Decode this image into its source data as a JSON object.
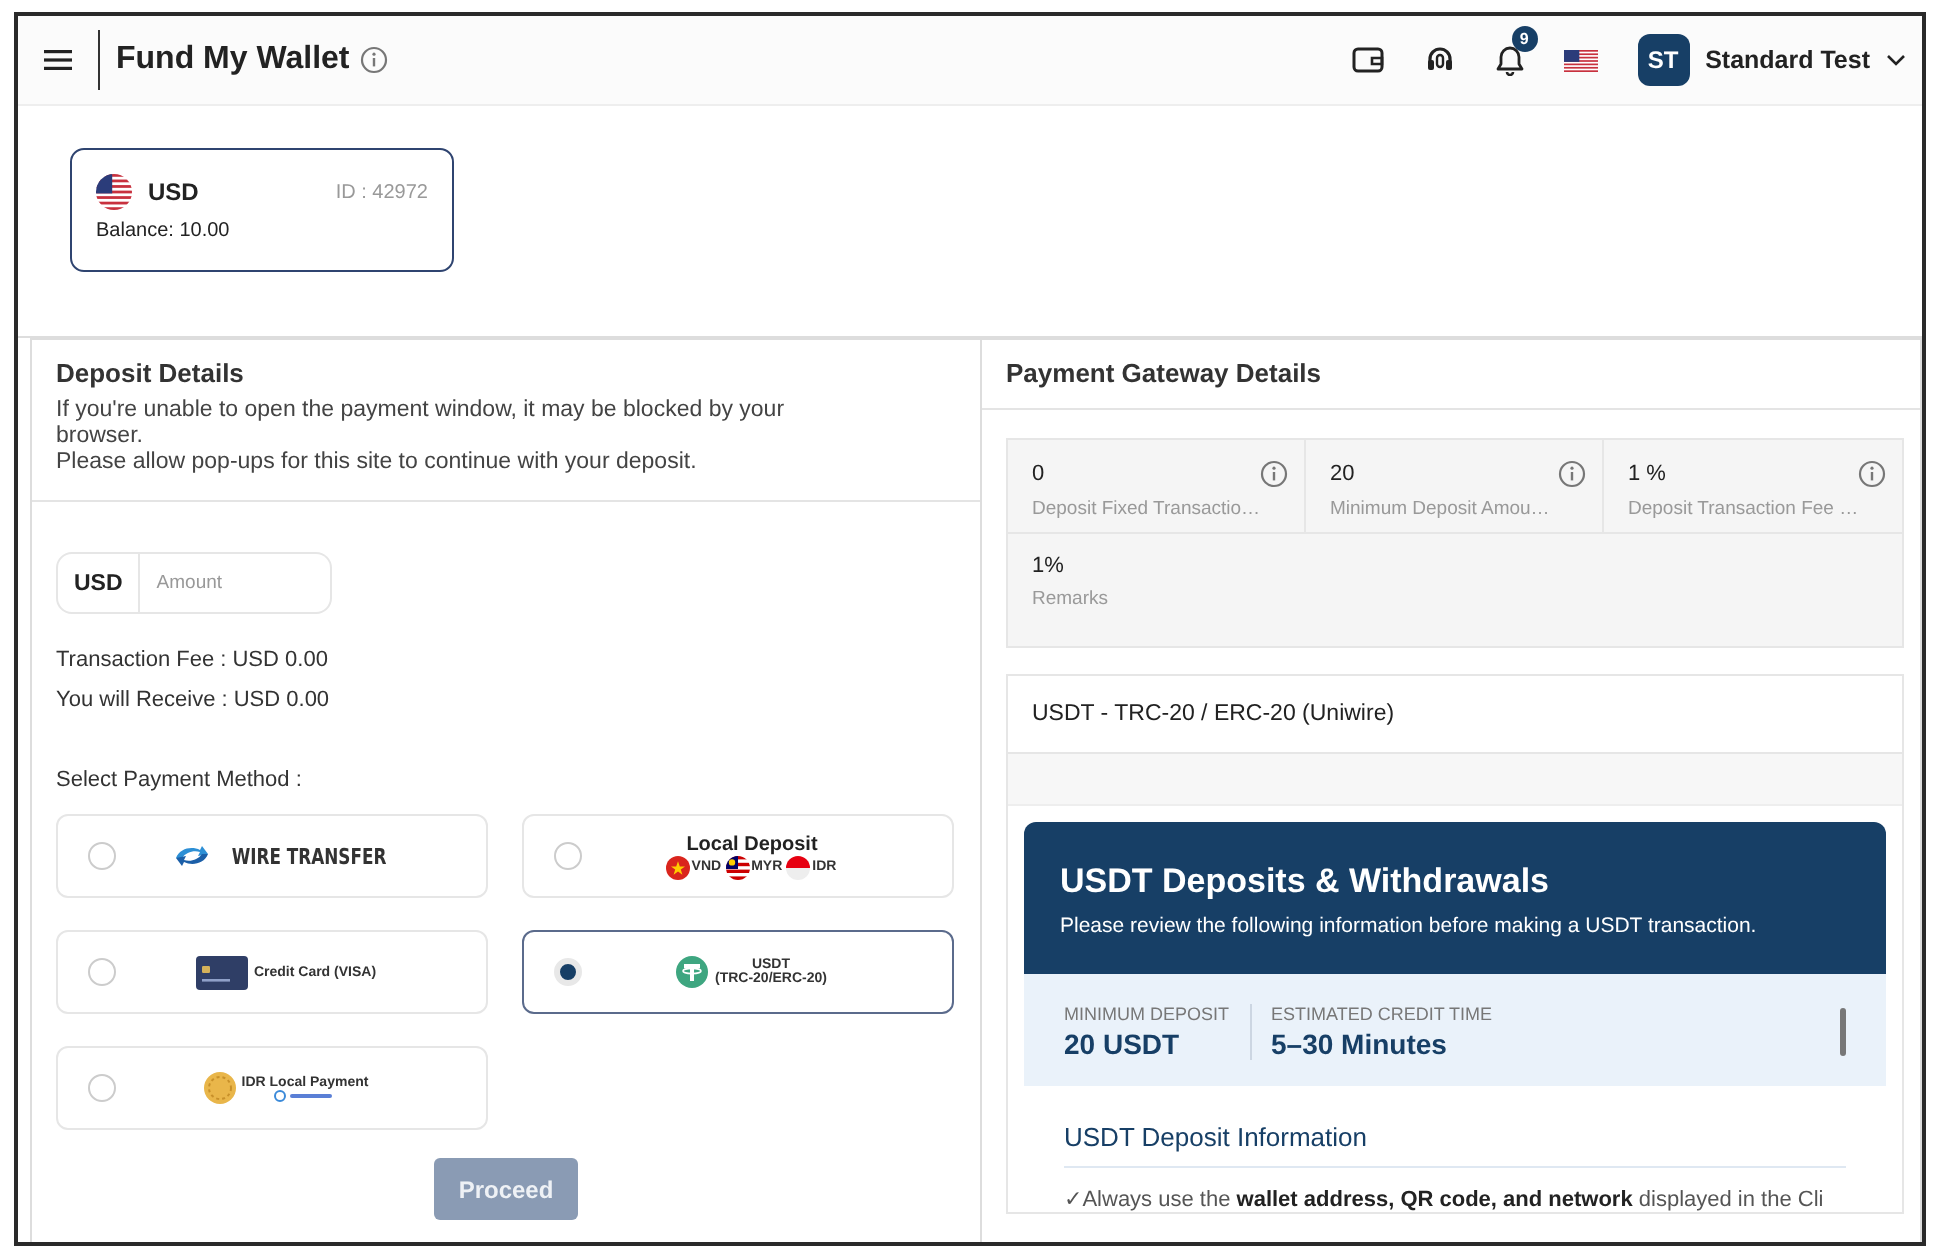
{
  "header": {
    "title": "Fund My Wallet",
    "notification_count": "9",
    "user": {
      "initials": "ST",
      "name": "Standard Test"
    }
  },
  "wallet": {
    "currency": "USD",
    "id": "ID : 42972",
    "balance": "Balance: 10.00"
  },
  "deposit": {
    "title": "Deposit Details",
    "notes": [
      "If you're unable to open the payment window, it may be blocked by your browser.",
      "Please allow pop-ups for this site to continue with your deposit."
    ],
    "amount": {
      "currency": "USD",
      "placeholder": "Amount"
    },
    "fee": "Transaction Fee : USD 0.00",
    "receive": "You will Receive : USD 0.00",
    "method_label": "Select Payment Method :",
    "methods": [
      {
        "kind": "wire",
        "label": "WIRE TRANSFER",
        "selected": false
      },
      {
        "kind": "local",
        "label": "Local Deposit",
        "currencies": [
          "VND",
          "MYR",
          "IDR"
        ],
        "selected": false
      },
      {
        "kind": "card",
        "label": "Credit Card (VISA)",
        "selected": false
      },
      {
        "kind": "usdt",
        "label": "USDT",
        "sublabel": "(TRC-20/ERC-20)",
        "selected": true
      },
      {
        "kind": "idr",
        "label": "IDR Local Payment",
        "selected": false
      }
    ],
    "proceed": {
      "label": "Proceed",
      "disabled": true
    }
  },
  "gateway": {
    "title": "Payment Gateway Details",
    "stats": [
      {
        "value": "0",
        "label": "Deposit Fixed Transactio…",
        "info": true
      },
      {
        "value": "20",
        "label": "Minimum Deposit Amou…",
        "info": true
      },
      {
        "value": "1 %",
        "label": "Deposit Transaction Fee …",
        "info": true
      },
      {
        "value": "1%",
        "label": "Remarks",
        "info": false
      }
    ],
    "method_title": "USDT - TRC-20 / ERC-20 (Uniwire)",
    "info_card": {
      "title": "USDT Deposits & Withdrawals",
      "subtitle": "Please review the following information before making a USDT transaction.",
      "facts": [
        {
          "label": "MINIMUM DEPOSIT",
          "value": "20 USDT"
        },
        {
          "label": "ESTIMATED CREDIT TIME",
          "value": "5–30 Minutes"
        }
      ],
      "section_title": "USDT Deposit Information",
      "bullets": [
        "✓Always use the **wallet address, QR code, and network** displayed in the Cli"
      ]
    }
  }
}
